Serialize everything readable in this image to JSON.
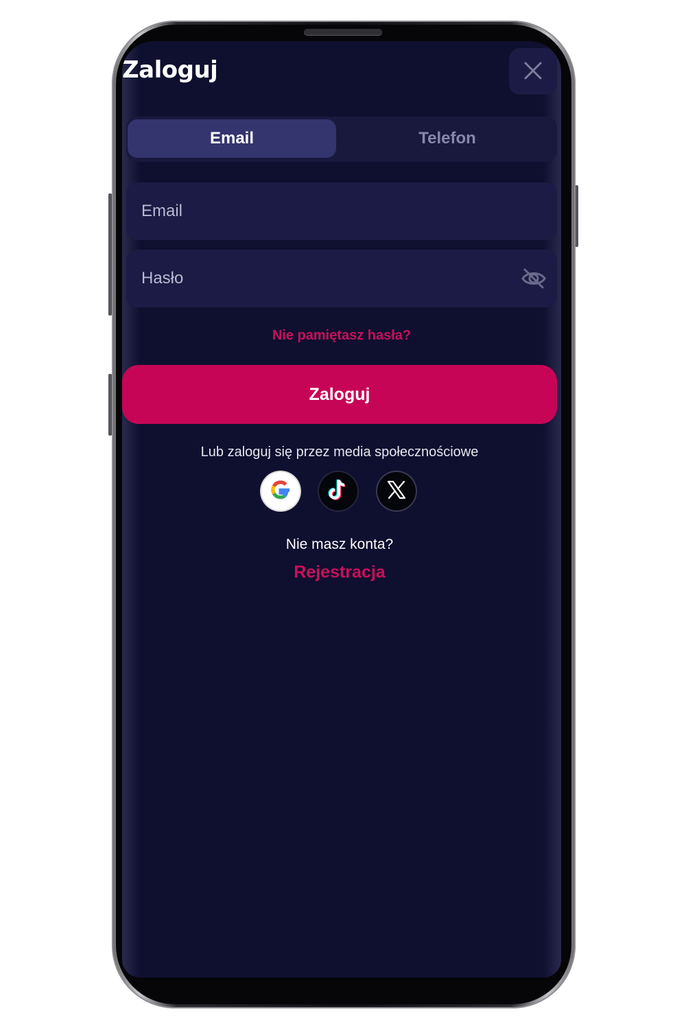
{
  "header": {
    "title": "Zaloguj",
    "close_icon": "close-icon"
  },
  "tabs": [
    {
      "label": "Email",
      "active": true
    },
    {
      "label": "Telefon",
      "active": false
    }
  ],
  "form": {
    "email_placeholder": "Email",
    "email_value": "",
    "password_placeholder": "Hasło",
    "password_value": "",
    "password_toggle_icon": "eye-off-icon",
    "forgot_link": "Nie pamiętasz hasła?",
    "submit_label": "Zaloguj"
  },
  "social": {
    "prompt": "Lub zaloguj się przez media społecznościowe",
    "providers": [
      {
        "name": "Google",
        "icon": "google-icon"
      },
      {
        "name": "TikTok",
        "icon": "tiktok-icon"
      },
      {
        "name": "X",
        "icon": "x-icon"
      }
    ]
  },
  "signup": {
    "prompt": "Nie masz konta?",
    "link": "Rejestracja"
  },
  "colors": {
    "background": "#0f0f2f",
    "surface": "#1b1b45",
    "tab_active": "#34346f",
    "accent": "#c70556",
    "accent_text": "#c8105a"
  }
}
